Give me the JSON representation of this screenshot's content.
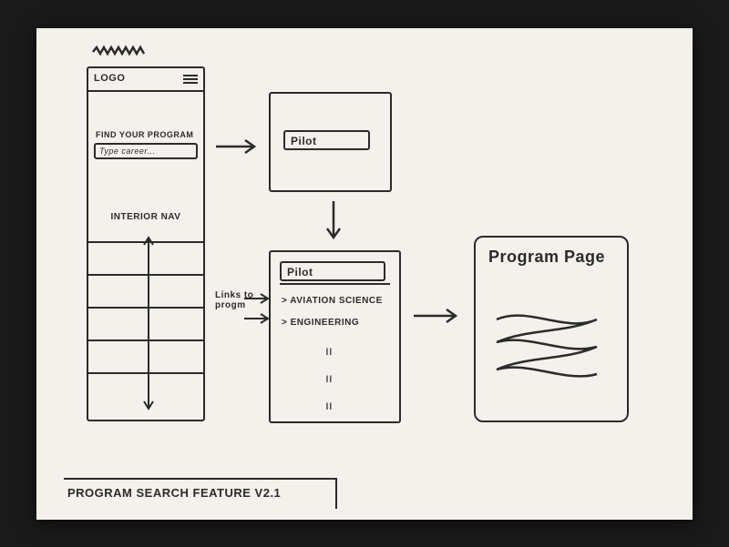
{
  "scribble_label": "",
  "mobile": {
    "logo": "LOGO",
    "search_label": "FIND YOUR PROGRAM",
    "search_placeholder": "Type career...",
    "interior_nav_label": "INTERIOR NAV"
  },
  "step2": {
    "input_value": "Pilot"
  },
  "step3": {
    "input_value": "Pilot",
    "annotation": "Links to progm",
    "results": {
      "0": "> AVIATION SCIENCE",
      "1": "> ENGINEERING"
    }
  },
  "step4": {
    "title": "Program Page"
  },
  "footer": "PROGRAM SEARCH FEATURE V2.1"
}
